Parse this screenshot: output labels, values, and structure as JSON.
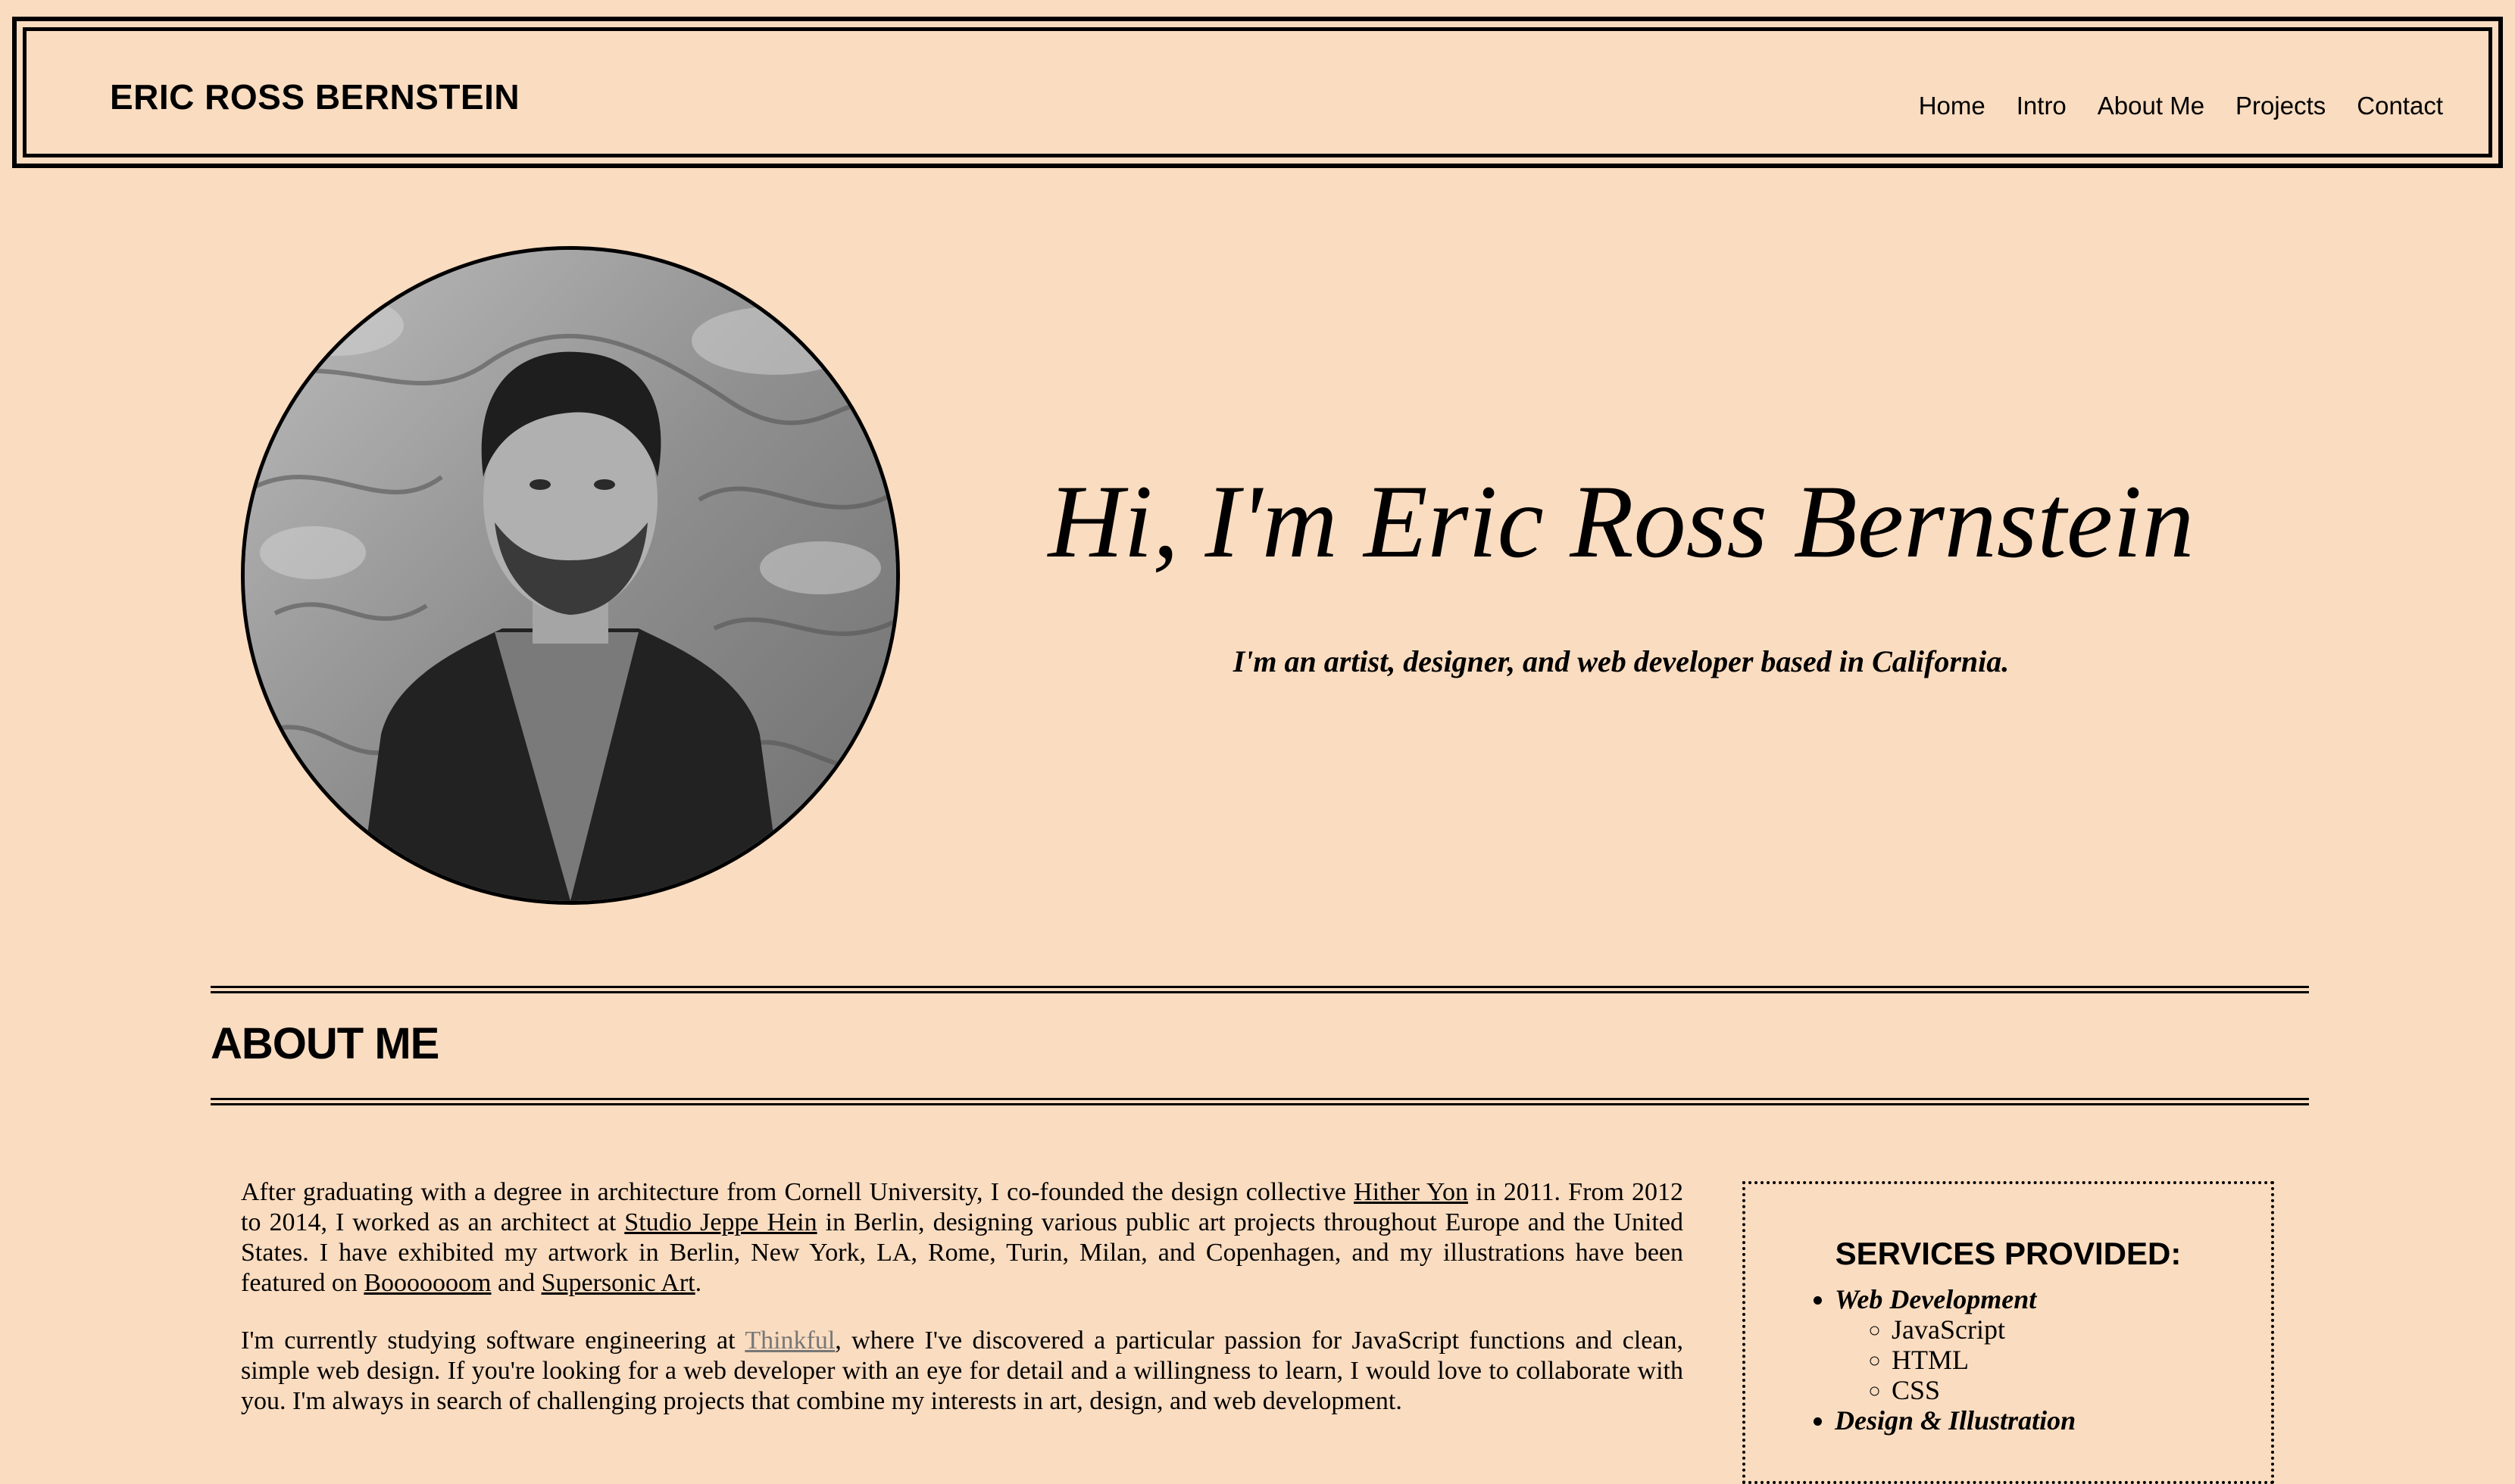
{
  "header": {
    "brand": "ERIC ROSS BERNSTEIN",
    "nav": [
      "Home",
      "Intro",
      "About Me",
      "Projects",
      "Contact"
    ]
  },
  "hero": {
    "title": "Hi, I'm Eric Ross Bernstein",
    "subtitle": "I'm an artist, designer, and web developer based in California."
  },
  "about": {
    "heading": "ABOUT ME",
    "p1": {
      "t1": "After graduating with a degree in architecture from Cornell University, I co-founded the design collective ",
      "link1": "Hither Yon",
      "t2": " in 2011. From 2012 to 2014, I worked as an architect at ",
      "link2": "Studio Jeppe Hein",
      "t3": " in Berlin, designing various public art projects throughout Europe and the United States. I have exhibited my artwork in Berlin, New York, LA, Rome, Turin, Milan, and Copenhagen, and my illustrations have been featured on ",
      "link3": "Booooooom",
      "t4": " and ",
      "link4": "Supersonic Art",
      "t5": "."
    },
    "p2": {
      "t1": "I'm currently studying software engineering at ",
      "link1": "Thinkful",
      "t2": ", where I've discovered a particular passion for JavaScript functions and clean, simple web design. If you're looking for a web developer with an eye for detail and a willingness to learn, I would love to collaborate with you. I'm always in search of challenging projects that combine my interests in art, design, and web development."
    }
  },
  "services": {
    "title": "SERVICES PROVIDED:",
    "cat1": "Web Development",
    "cat1_items": [
      "JavaScript",
      "HTML",
      "CSS"
    ],
    "cat2": "Design & Illustration"
  },
  "icons": {
    "portrait": "person-photo"
  }
}
